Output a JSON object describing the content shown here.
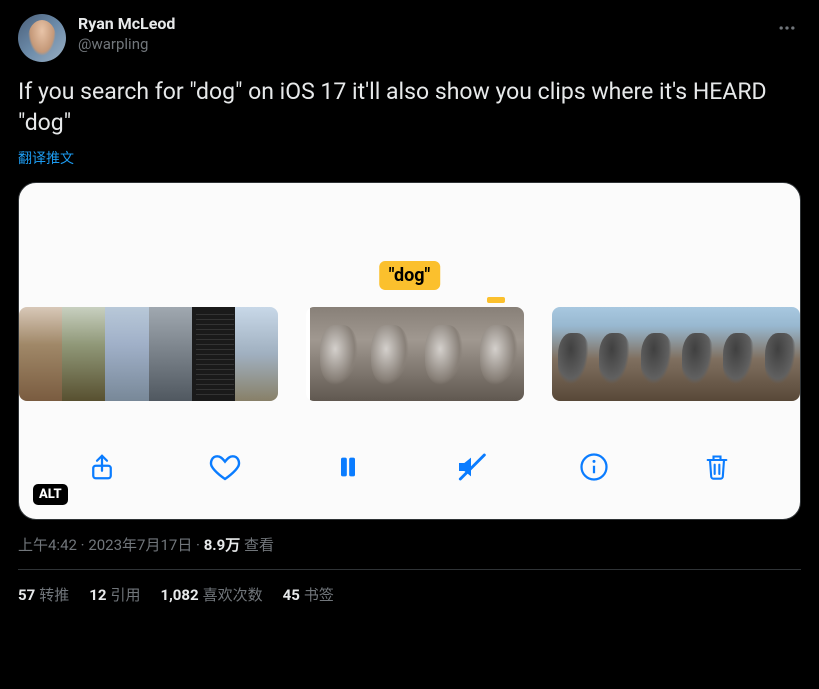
{
  "user": {
    "display_name": "Ryan McLeod",
    "handle": "@warpling"
  },
  "tweet_text": "If you search for \"dog\" on iOS 17 it'll also show you clips where it's HEARD \"dog\"",
  "translate_label": "翻译推文",
  "media": {
    "caption": "\"dog\"",
    "alt_badge": "ALT",
    "toolbar_icons": [
      "share-icon",
      "heart-icon",
      "pause-icon",
      "mute-icon",
      "info-icon",
      "trash-icon"
    ]
  },
  "meta": {
    "time": "上午4:42",
    "sep1": " · ",
    "date": "2023年7月17日",
    "sep2": " · ",
    "views_num": "8.9万",
    "views_label": " 查看"
  },
  "stats": {
    "retweets_num": "57",
    "retweets_label": "转推",
    "quotes_num": "12",
    "quotes_label": "引用",
    "likes_num": "1,082",
    "likes_label": "喜欢次数",
    "bookmarks_num": "45",
    "bookmarks_label": "书签"
  }
}
